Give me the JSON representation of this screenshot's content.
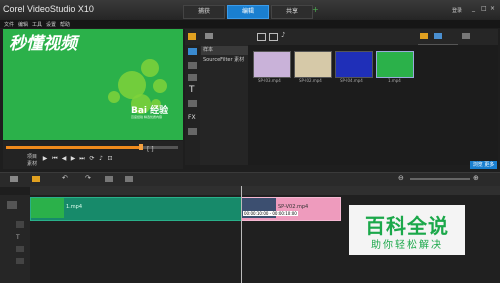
{
  "app": {
    "title": "Corel VideoStudio X10",
    "window_buttons": [
      "_",
      "□",
      "×"
    ]
  },
  "steps": [
    {
      "label": "捕获",
      "active": false
    },
    {
      "label": "编辑",
      "active": true
    },
    {
      "label": "共享",
      "active": false
    }
  ],
  "menu": [
    "文件",
    "编辑",
    "工具",
    "设置",
    "帮助"
  ],
  "user_label": "登录",
  "watermark": "秒懂视频",
  "preview": {
    "brand": "Bai 经验",
    "brand_sub": "百度经验 精选优质内容",
    "modes": [
      "项目",
      "素材"
    ],
    "brackets": "[ ]"
  },
  "library": {
    "folders": [
      {
        "label": "样本",
        "selected": true
      },
      {
        "label": "SourceFilter 素材",
        "selected": false
      }
    ],
    "thumbs": [
      {
        "label": "SP-I03.mp4",
        "color": "#c9b2d9"
      },
      {
        "label": "SP-I02.mp4",
        "color": "#d6c9a8"
      },
      {
        "label": "SP-I04.mp4",
        "color": "#1f2fb8"
      },
      {
        "label": "1.mp4",
        "color": "#2bb14a"
      }
    ],
    "bottom_button": "浏览 更多"
  },
  "timeline": {
    "clip1_label": "1.mp4",
    "clip2_label": "SP-V02.mp4",
    "timecode": "00:00:10:00 - 00:00:10:00"
  },
  "brand_overlay": {
    "title": "百科全说",
    "subtitle": "助你轻松解决"
  }
}
